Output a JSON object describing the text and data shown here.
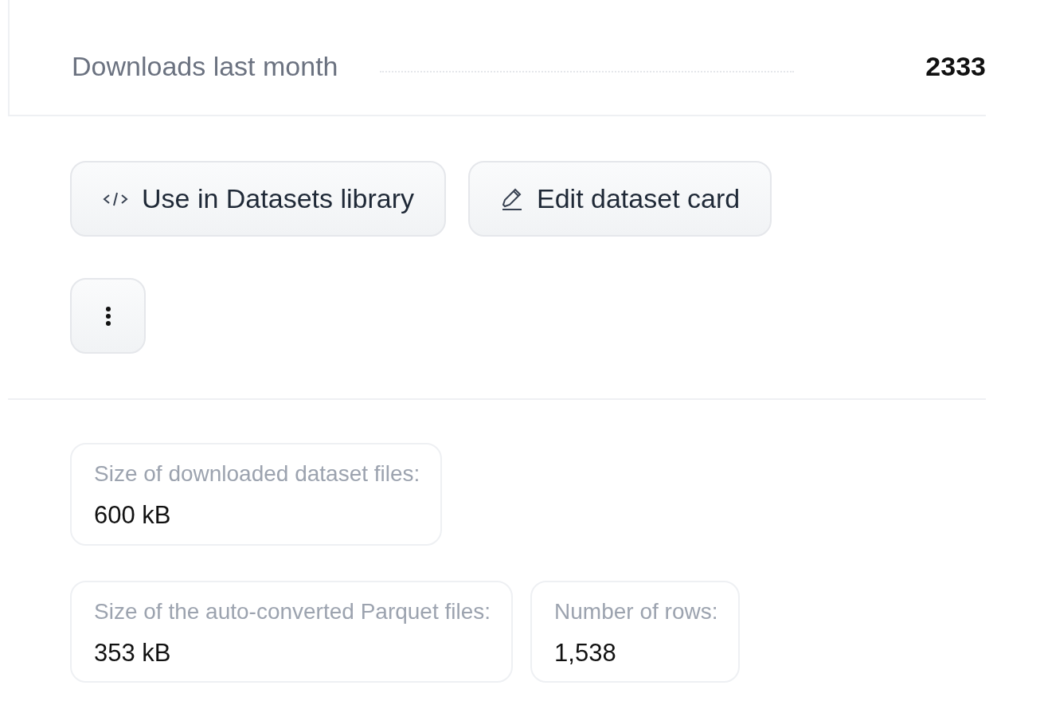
{
  "downloads": {
    "label": "Downloads last month",
    "value": "2333"
  },
  "actions": [
    {
      "kind": "code",
      "label": "Use in Datasets library"
    },
    {
      "kind": "edit",
      "label": "Edit dataset card"
    },
    {
      "kind": "more"
    }
  ],
  "stats": [
    {
      "label": "Size of downloaded dataset files:",
      "value": "600 kB"
    },
    {
      "label": "Size of the auto-converted Parquet files:",
      "value": "353 kB"
    },
    {
      "label": "Number of rows:",
      "value": "1,538"
    }
  ]
}
